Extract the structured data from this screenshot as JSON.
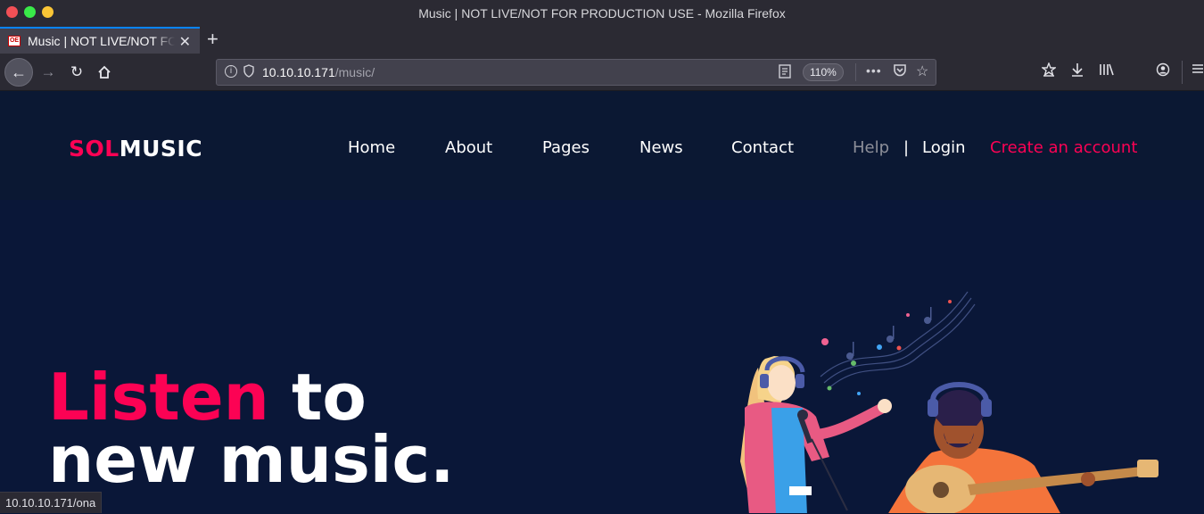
{
  "window": {
    "title": "Music | NOT LIVE/NOT FOR PRODUCTION USE - Mozilla Firefox"
  },
  "tab": {
    "favicon_text": "OE",
    "label": "Music | NOT LIVE/NOT FOR PRODUCTION USE",
    "close": "✕",
    "new_tab": "+"
  },
  "toolbar": {
    "back": "←",
    "forward": "→",
    "reload": "↻",
    "home": "⌂",
    "url_host": "10.10.10.171",
    "url_path": "/music/",
    "zoom": "110%",
    "more": "•••",
    "pocket": "◫",
    "star": "☆"
  },
  "site": {
    "logo_accent": "SOL",
    "logo_main": "MUSIC",
    "nav": [
      "Home",
      "About",
      "Pages",
      "News",
      "Contact"
    ],
    "help": "Help",
    "separator": "|",
    "login": "Login",
    "create_account": "Create an account",
    "hero_accent": "Listen",
    "hero_rest": " to",
    "hero_line2": "new music.",
    "colors": {
      "accent": "#fc0254",
      "background": "#0a1738",
      "header": "#0b1833"
    }
  },
  "status": {
    "link": "10.10.10.171/ona"
  }
}
